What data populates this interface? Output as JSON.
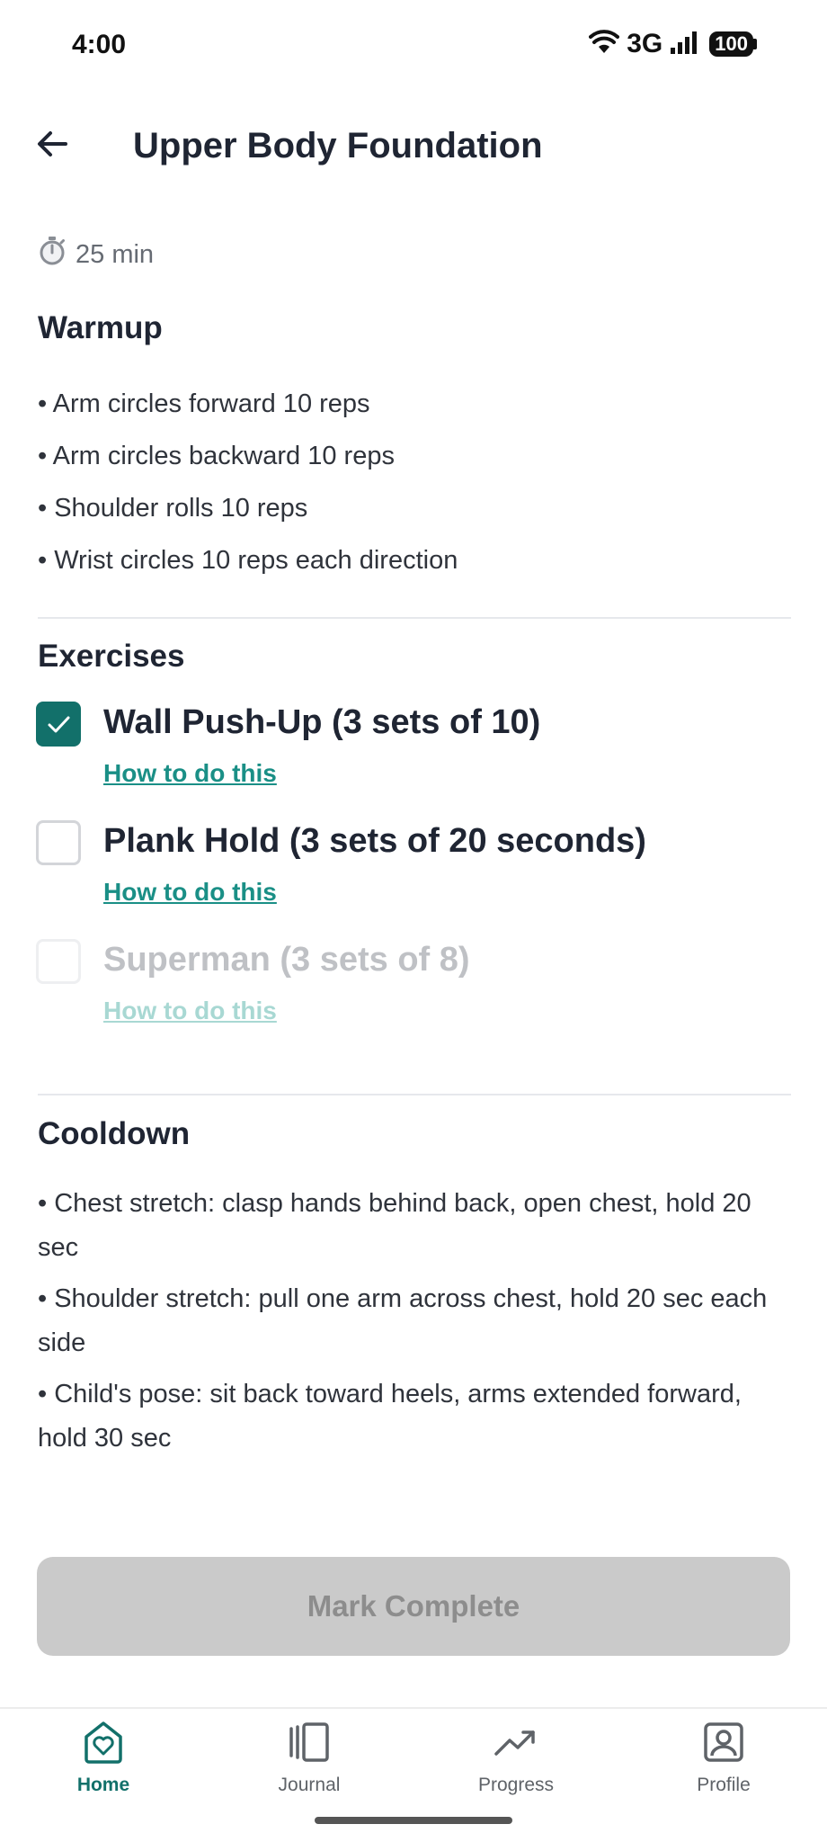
{
  "status": {
    "time": "4:00",
    "network": "3G",
    "battery": "100"
  },
  "header": {
    "title": "Upper Body Foundation"
  },
  "duration": "25 min",
  "warmup": {
    "title": "Warmup",
    "items": [
      "• Arm circles forward 10 reps",
      "• Arm circles backward 10 reps",
      "• Shoulder rolls 10 reps",
      "• Wrist circles 10 reps each direction"
    ]
  },
  "exercises": {
    "title": "Exercises",
    "items": [
      {
        "name": "Wall Push-Up (3 sets of 10)",
        "link": "How to do this",
        "checked": true
      },
      {
        "name": "Plank Hold (3 sets of 20 seconds)",
        "link": "How to do this",
        "checked": false
      },
      {
        "name": "Superman (3 sets of 8)",
        "link": "How to do this",
        "checked": false
      }
    ]
  },
  "cooldown": {
    "title": "Cooldown",
    "items": [
      "• Chest stretch: clasp hands behind back, open chest, hold 20 sec",
      "• Shoulder stretch: pull one arm across chest, hold 20 sec each side",
      "• Child's pose: sit back toward heels, arms extended forward, hold 30 sec"
    ]
  },
  "action": {
    "mark_complete": "Mark Complete"
  },
  "nav": {
    "items": [
      {
        "label": "Home",
        "icon": "home-heart-icon",
        "active": true
      },
      {
        "label": "Journal",
        "icon": "journal-icon",
        "active": false
      },
      {
        "label": "Progress",
        "icon": "trending-up-icon",
        "active": false
      },
      {
        "label": "Profile",
        "icon": "profile-icon",
        "active": false
      }
    ]
  },
  "colors": {
    "accent": "#12706a",
    "link": "#1a8f86",
    "disabled_button": "#cacaca"
  }
}
